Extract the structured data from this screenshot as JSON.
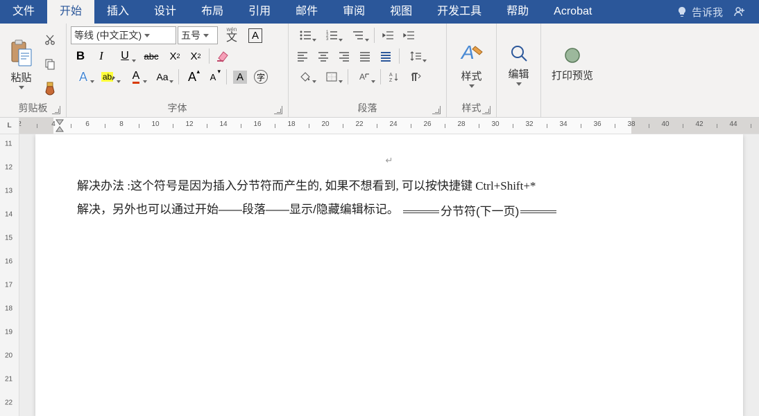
{
  "tabs": [
    "文件",
    "开始",
    "插入",
    "设计",
    "布局",
    "引用",
    "邮件",
    "审阅",
    "视图",
    "开发工具",
    "帮助",
    "Acrobat"
  ],
  "active_tab": 1,
  "tellme_placeholder": "告诉我",
  "groups": {
    "clipboard": {
      "label": "剪贴板",
      "paste": "粘贴"
    },
    "font": {
      "label": "字体",
      "name": "等线 (中文正文)",
      "size": "五号",
      "phonetic_top": "wén",
      "phonetic_char": "文",
      "bold": "B",
      "italic": "I",
      "underline": "U",
      "strike": "abc",
      "sub": "X",
      "sup": "X",
      "grow": "A",
      "shrink": "A",
      "case": "Aa",
      "clear": "A",
      "highlight": "ab"
    },
    "paragraph": {
      "label": "段落"
    },
    "styles": {
      "label": "样式",
      "btn": "样式"
    },
    "edit": {
      "btn": "编辑"
    },
    "preview": {
      "btn": "打印预览"
    }
  },
  "ruler_h": {
    "start": 2,
    "margin_end": 4,
    "body_end": 38,
    "end": 48
  },
  "ruler_v": {
    "start": 11,
    "end": 22
  },
  "document": {
    "line1": "解决办法 :这个符号是因为插入分节符而产生的, 如果不想看到, 可以按快捷键 Ctrl+Shift+*",
    "line2_a": "解决，另外也可以通过开始——段落——显示/隐藏编辑标记。",
    "section_break": "分节符(下一页)"
  }
}
